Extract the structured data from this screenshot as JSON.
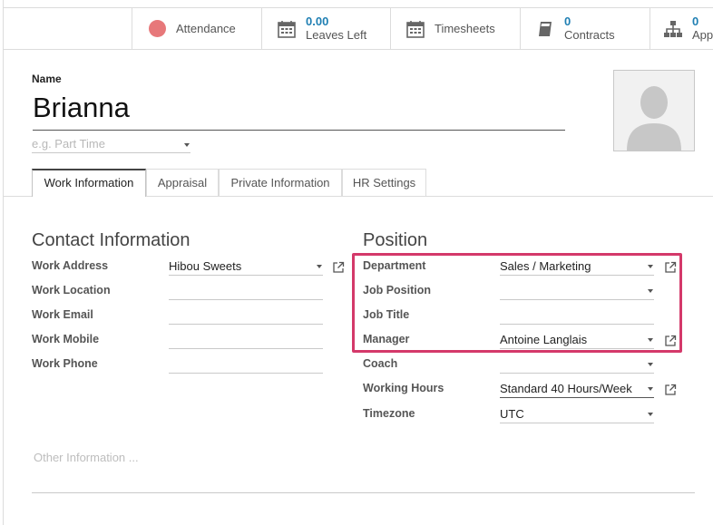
{
  "smart_buttons": {
    "attendance": {
      "label": "Attendance"
    },
    "leaves": {
      "value": "0.00",
      "label": "Leaves Left"
    },
    "timesheets": {
      "label": "Timesheets"
    },
    "contracts": {
      "value": "0",
      "label": "Contracts"
    },
    "appraisals": {
      "value": "0",
      "label": "Appr"
    }
  },
  "header": {
    "name_label": "Name",
    "name_value": "Brianna",
    "tag_placeholder": "e.g. Part Time"
  },
  "tabs": [
    {
      "label": "Work Information",
      "active": true
    },
    {
      "label": "Appraisal"
    },
    {
      "label": "Private Information"
    },
    {
      "label": "HR Settings"
    }
  ],
  "contact": {
    "title": "Contact Information",
    "fields": [
      {
        "label": "Work Address",
        "value": "Hibou Sweets"
      },
      {
        "label": "Work Location",
        "value": ""
      },
      {
        "label": "Work Email",
        "value": ""
      },
      {
        "label": "Work Mobile",
        "value": ""
      },
      {
        "label": "Work Phone",
        "value": ""
      }
    ]
  },
  "position": {
    "title": "Position",
    "fields": [
      {
        "label": "Department",
        "value": "Sales / Marketing"
      },
      {
        "label": "Job Position",
        "value": ""
      },
      {
        "label": "Job Title",
        "value": ""
      },
      {
        "label": "Manager",
        "value": "Antoine Langlais"
      },
      {
        "label": "Coach",
        "value": ""
      },
      {
        "label": "Working Hours",
        "value": "Standard 40 Hours/Week"
      },
      {
        "label": "Timezone",
        "value": "UTC"
      }
    ]
  },
  "other_placeholder": "Other Information ...",
  "colors": {
    "accent_number": "#1f7fb3",
    "highlight": "#d4396a",
    "attendance_dot": "#e7787a"
  }
}
